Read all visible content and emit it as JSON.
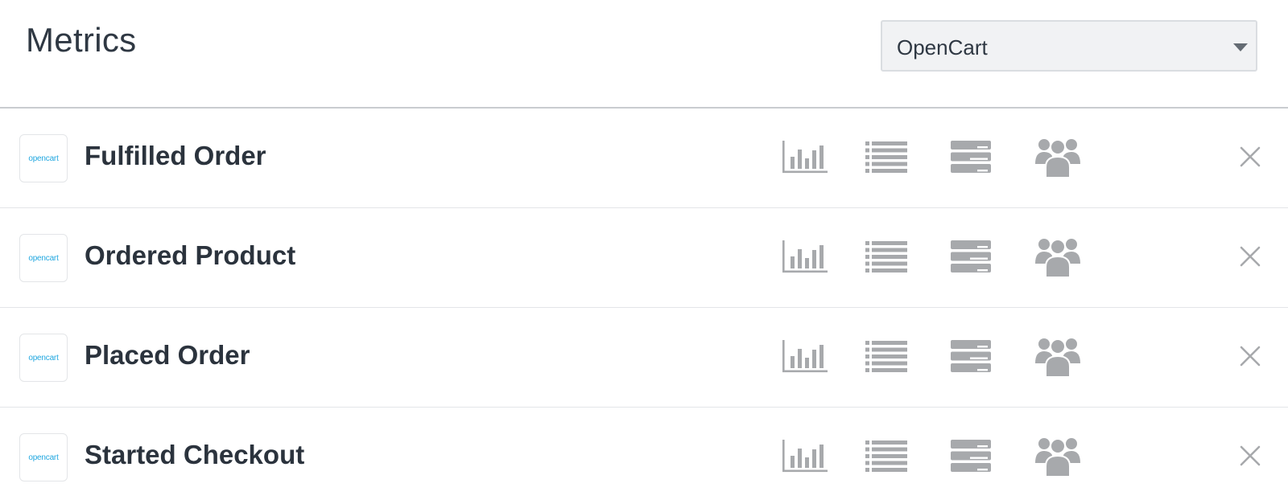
{
  "header": {
    "title": "Metrics",
    "integration_select": {
      "value": "OpenCart"
    }
  },
  "icon_color": "#a7a9ac",
  "logo_color": "#23a8e0",
  "logo_text": "opencart",
  "metrics": [
    {
      "name": "Fulfilled Order"
    },
    {
      "name": "Ordered Product"
    },
    {
      "name": "Placed Order"
    },
    {
      "name": "Started Checkout"
    }
  ],
  "row_actions": [
    "bar-chart-icon",
    "list-icon",
    "table-icon",
    "people-icon",
    "close-icon"
  ]
}
